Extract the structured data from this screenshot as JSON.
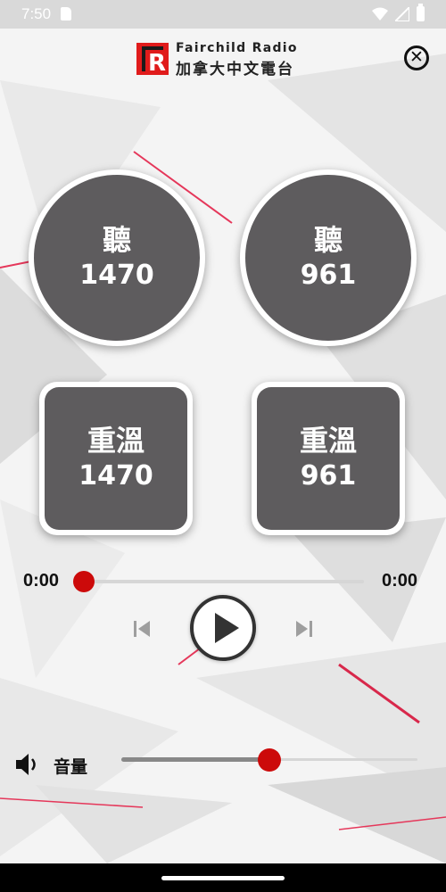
{
  "status_bar": {
    "time": "7:50"
  },
  "header": {
    "brand_en": "Fairchild Radio",
    "brand_zh": "加拿大中文電台",
    "logo_letter": "R"
  },
  "live_buttons": [
    {
      "label": "聽",
      "station": "1470"
    },
    {
      "label": "聽",
      "station": "961"
    }
  ],
  "replay_buttons": [
    {
      "label": "重溫",
      "station": "1470"
    },
    {
      "label": "重溫",
      "station": "961"
    }
  ],
  "player": {
    "elapsed": "0:00",
    "duration": "0:00",
    "progress": 0
  },
  "volume": {
    "label": "音量",
    "level": 0.5
  },
  "colors": {
    "accent": "#cc0a0a",
    "button_fill": "#5e5c5e"
  },
  "icons": {
    "close": "close-icon",
    "prev": "skip-previous-icon",
    "play": "play-icon",
    "next": "skip-next-icon",
    "volume": "speaker-icon"
  }
}
